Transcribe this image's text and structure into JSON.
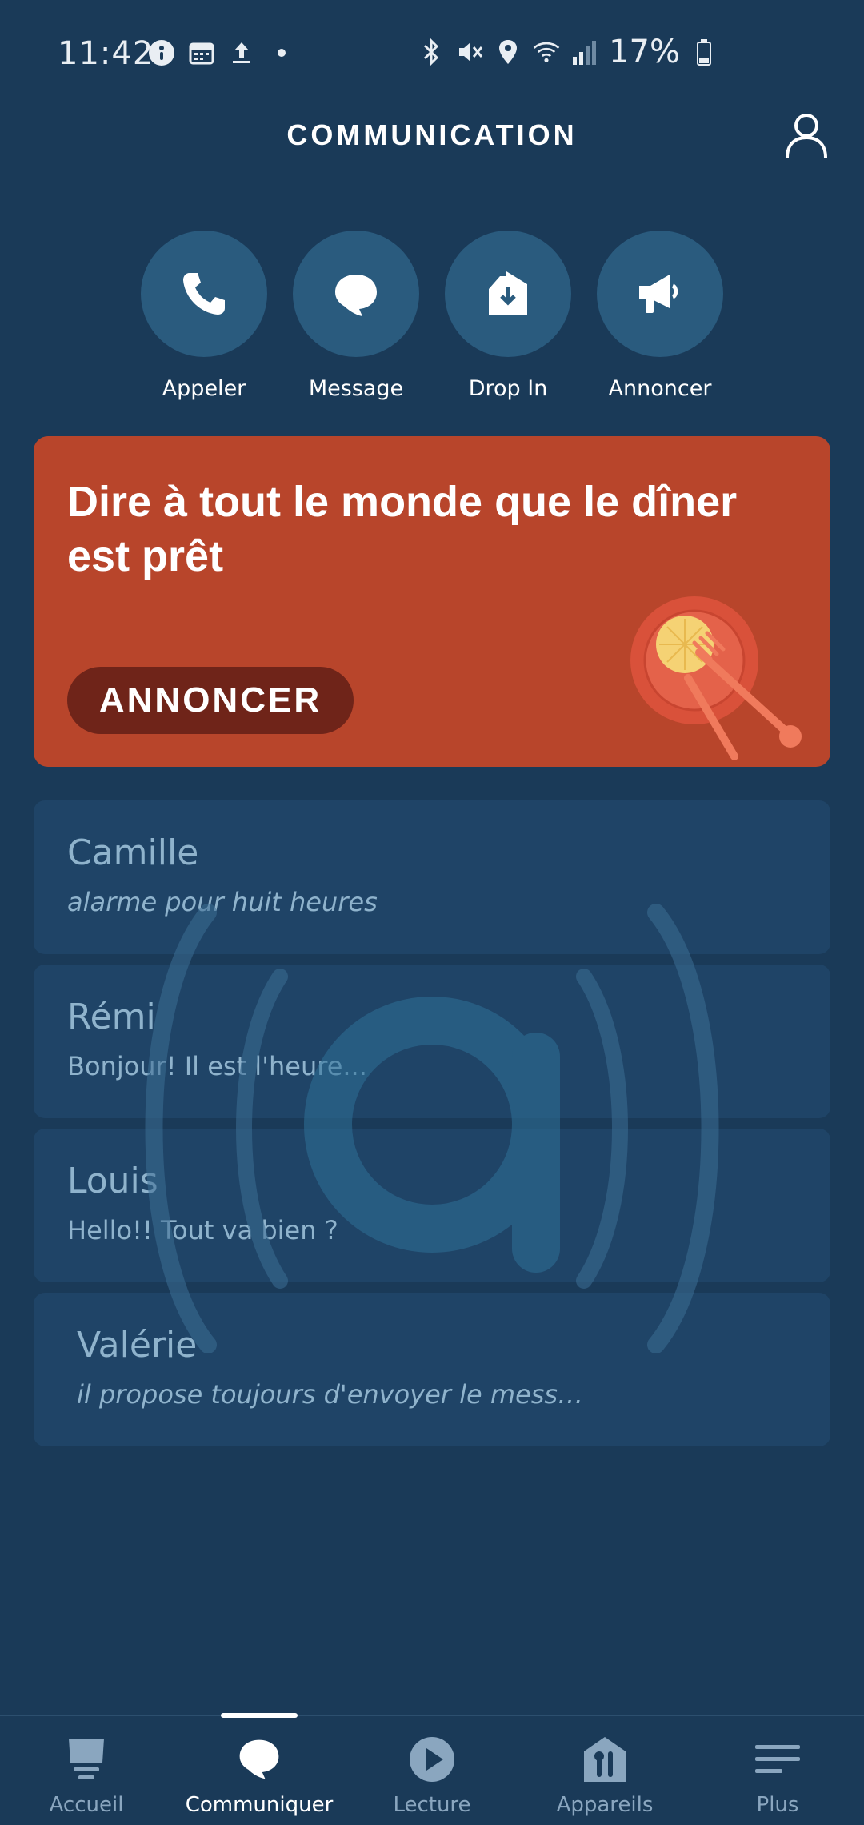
{
  "status_bar": {
    "time": "11:42",
    "battery": "17%",
    "left_icons": [
      "whatsapp-icon",
      "calendar-icon",
      "upload-icon",
      "dot-icon"
    ],
    "right_icons": [
      "bluetooth-icon",
      "mute-icon",
      "location-icon",
      "wifi-icon",
      "signal-icon",
      "battery-icon"
    ]
  },
  "header": {
    "title": "COMMUNICATION"
  },
  "actions": [
    {
      "label": "Appeler",
      "icon": "phone-icon"
    },
    {
      "label": "Message",
      "icon": "chat-bubble-icon"
    },
    {
      "label": "Drop In",
      "icon": "drop-in-icon"
    },
    {
      "label": "Annoncer",
      "icon": "megaphone-icon"
    }
  ],
  "promo": {
    "title": "Dire à tout le monde que le dîner est prêt",
    "button": "ANNONCER"
  },
  "contacts": [
    {
      "name": "Camille",
      "message": "alarme pour huit heures"
    },
    {
      "name": "Rémi",
      "message": "Bonjour! Il est l'heure..."
    },
    {
      "name": "Louis",
      "message": "Hello!! Tout va bien ?"
    },
    {
      "name": "Valérie",
      "message": "il propose toujours d'envoyer le mess…"
    }
  ],
  "nav": [
    {
      "label": "Accueil",
      "icon": "home-icon"
    },
    {
      "label": "Communiquer",
      "icon": "chat-bubble-icon",
      "active": true
    },
    {
      "label": "Lecture",
      "icon": "play-icon"
    },
    {
      "label": "Appareils",
      "icon": "devices-icon"
    },
    {
      "label": "Plus",
      "icon": "menu-icon"
    }
  ],
  "colors": {
    "background": "#1a3a58",
    "action_circle": "#2a5b7e",
    "promo": "#b8452b",
    "promo_button": "#6f2419",
    "contact_card": "#1f4467",
    "contact_text": "#8fb3cc"
  }
}
